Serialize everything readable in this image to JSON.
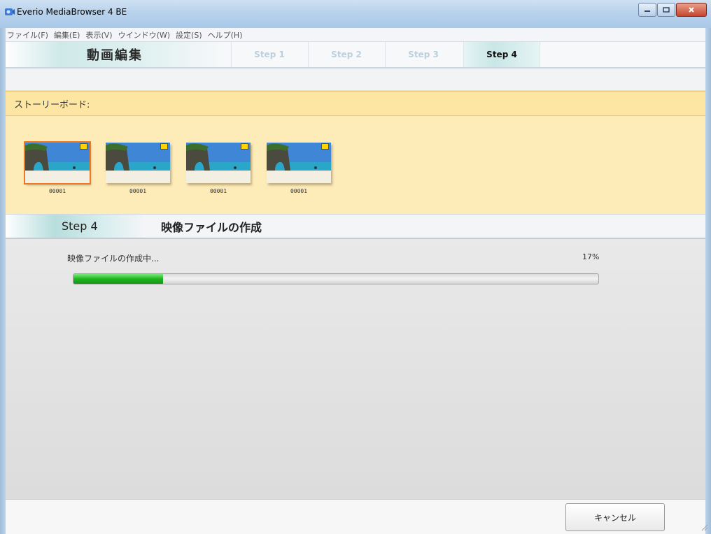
{
  "window": {
    "title": "Everio MediaBrowser 4 BE"
  },
  "menu": [
    "ファイル(F)",
    "編集(E)",
    "表示(V)",
    "ウインドウ(W)",
    "設定(S)",
    "ヘルプ(H)"
  ],
  "step_header": {
    "title": "動画編集",
    "tabs": [
      "Step 1",
      "Step 2",
      "Step 3",
      "Step 4"
    ],
    "active_tab": "Step 4"
  },
  "storyboard": {
    "label": "ストーリーボード:",
    "clips": [
      {
        "label": "00001",
        "selected": true
      },
      {
        "label": "00001",
        "selected": false
      },
      {
        "label": "00001",
        "selected": false
      },
      {
        "label": "00001",
        "selected": false
      }
    ]
  },
  "step4": {
    "step_label": "Step 4",
    "title": "映像ファイルの作成"
  },
  "progress": {
    "label": "映像ファイルの作成中...",
    "percent_text": "17%",
    "value": 0.17
  },
  "footer": {
    "cancel_label": "キャンセル"
  },
  "colors": {
    "progress_fill": "#1fb51f",
    "selection_outline": "#f07a22",
    "storyboard_bg": "#fdebb8"
  }
}
